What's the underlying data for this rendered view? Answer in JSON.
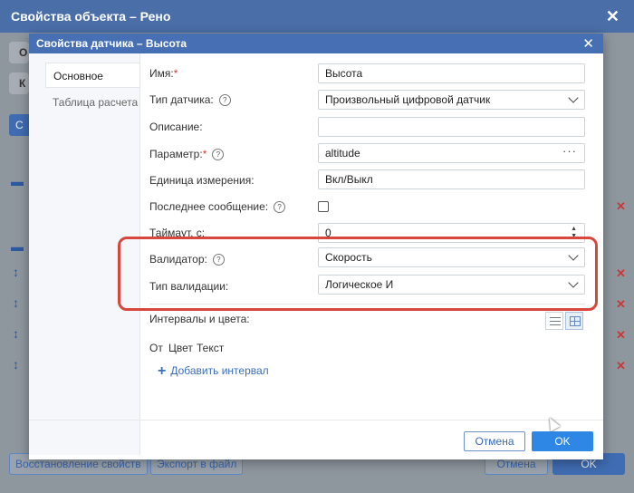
{
  "background_window": {
    "title": "Свойства объекта – Рено",
    "left_partial_1": "О",
    "left_partial_2": "К",
    "left_partial_3": "С",
    "restore_button": "Восстановление свойств",
    "export_button": "Экспорт в файл",
    "cancel_button": "Отмена",
    "ok_button": "OK"
  },
  "dialog": {
    "title": "Свойства датчика – Высота",
    "tabs": [
      {
        "label": "Основное",
        "active": true
      },
      {
        "label": "Таблица расчета",
        "active": false
      }
    ],
    "fields": {
      "name": {
        "label": "Имя:",
        "required": "*",
        "value": "Высота"
      },
      "sensor_type": {
        "label": "Тип датчика:",
        "value": "Произвольный цифровой датчик"
      },
      "description": {
        "label": "Описание:",
        "value": ""
      },
      "parameter": {
        "label": "Параметр:",
        "required": "*",
        "value": "altitude",
        "action": "···"
      },
      "unit": {
        "label": "Единица измерения:",
        "value": "Вкл/Выкл"
      },
      "last_message": {
        "label": "Последнее сообщение:",
        "checked": false
      },
      "timeout": {
        "label": "Таймаут, с:",
        "value": "0"
      },
      "validator": {
        "label": "Валидатор:",
        "value": "Скорость"
      },
      "validation_type": {
        "label": "Тип валидации:",
        "value": "Логическое И"
      }
    },
    "intervals": {
      "label": "Интервалы и цвета:",
      "columns": [
        "От",
        "Цвет",
        "Текст"
      ],
      "add_label": "Добавить интервал"
    },
    "help_glyph": "?",
    "buttons": {
      "cancel": "Отмена",
      "ok": "OK"
    }
  },
  "colors": {
    "header_blue": "#4670b3",
    "ok_blue": "#2e87e5",
    "highlight_red": "#d9463d",
    "required_red": "#d9363e"
  }
}
